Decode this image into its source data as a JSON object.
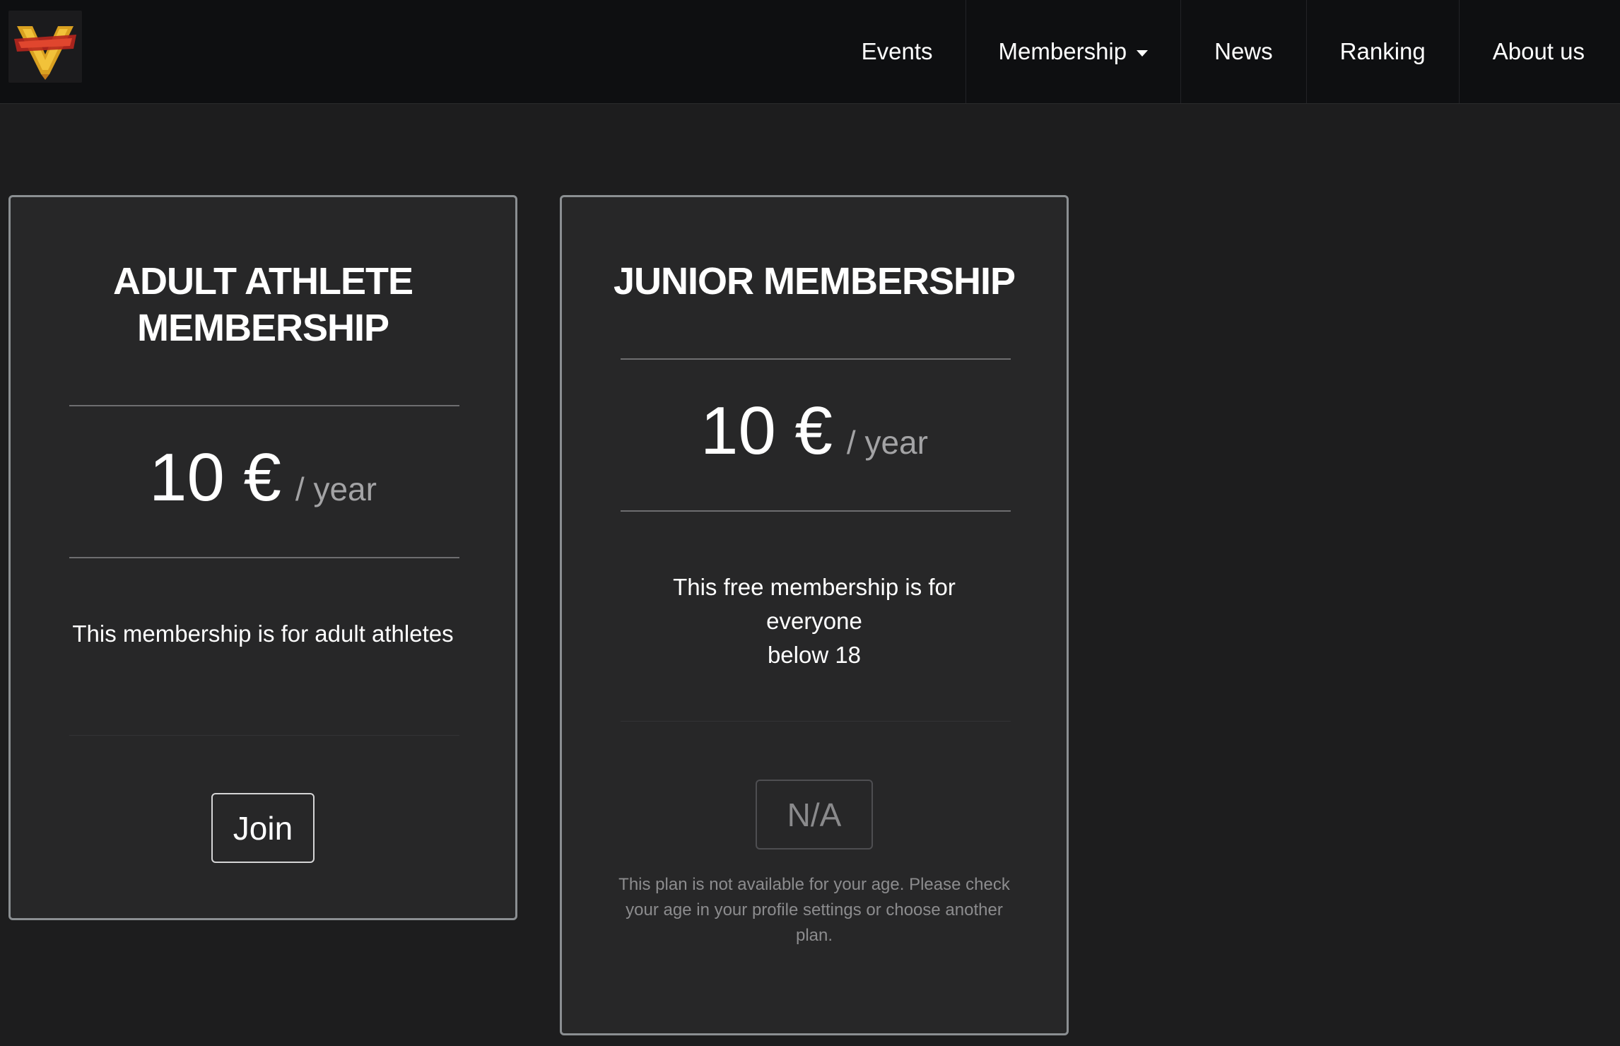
{
  "navbar": {
    "logo_alt": "Street Fighter V logo",
    "items": [
      {
        "label": "Events"
      },
      {
        "label": "Membership",
        "has_dropdown": true
      },
      {
        "label": "News"
      },
      {
        "label": "Ranking"
      },
      {
        "label": "About us"
      }
    ]
  },
  "plans": [
    {
      "title_line1": "ADULT ATHLETE",
      "title_line2": "MEMBERSHIP",
      "price": "10 €",
      "period": "/ year",
      "description": "This membership is for adult athletes",
      "button_label": "Join",
      "available": true
    },
    {
      "title_line1": "JUNIOR MEMBERSHIP",
      "price": "10 €",
      "period": "/ year",
      "description_line1": "This free membership is for everyone",
      "description_line2": "below 18",
      "button_label": "N/A",
      "available": false,
      "note_line1": "This plan is not available for your age. Please check",
      "note_line2": "your age in your profile settings or choose another",
      "note_line3": "plan."
    }
  ],
  "colors": {
    "page_bg": "#1d1d1e",
    "navbar_bg": "#0e0f11",
    "card_bg": "#272728",
    "card_border": "#8b8f92",
    "muted_text": "#8c8c8e"
  }
}
